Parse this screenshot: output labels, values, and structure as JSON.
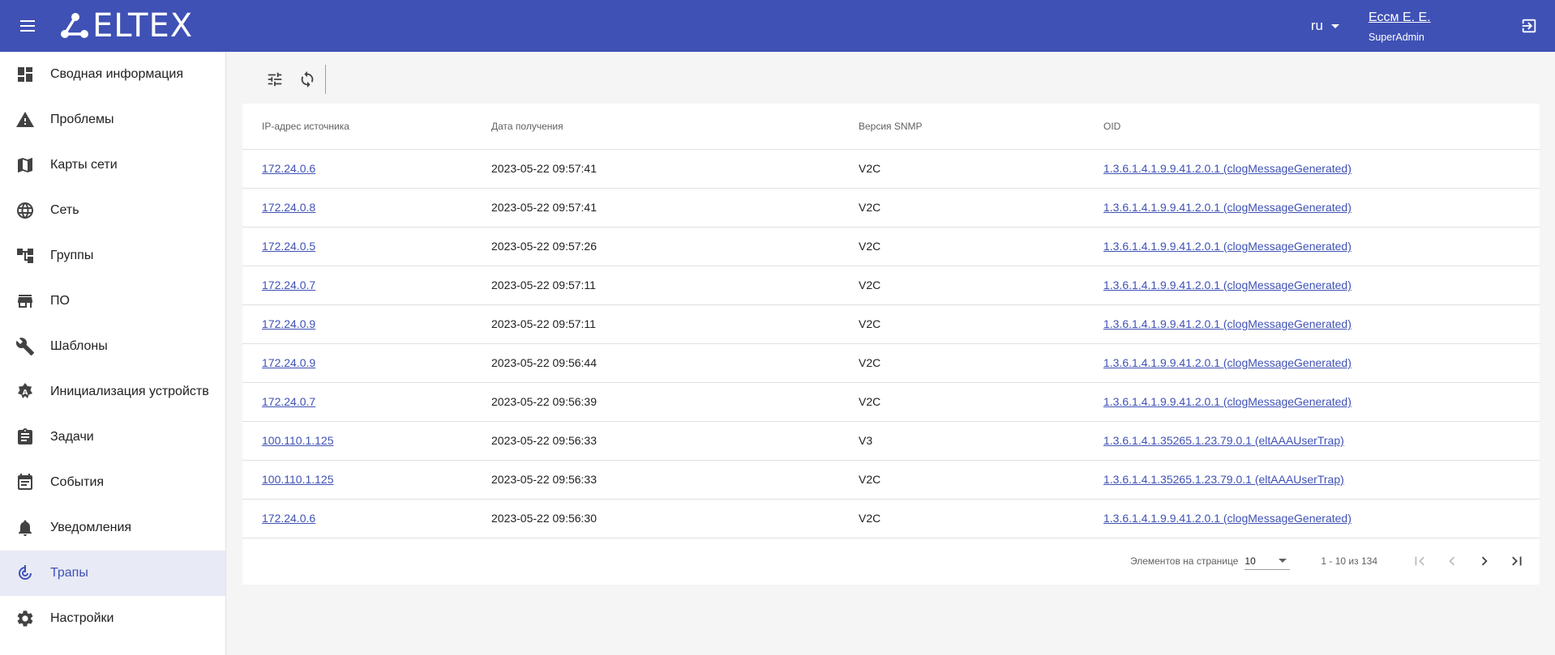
{
  "header": {
    "brand": "ELTEX",
    "language": "ru",
    "user_name": "Ессм Е. Е.",
    "user_role": "SuperAdmin"
  },
  "sidebar": {
    "items": [
      {
        "label": "Сводная информация",
        "icon": "dashboard-icon",
        "active": false
      },
      {
        "label": "Проблемы",
        "icon": "warning-icon",
        "active": false
      },
      {
        "label": "Карты сети",
        "icon": "map-icon",
        "active": false
      },
      {
        "label": "Сеть",
        "icon": "globe-icon",
        "active": false
      },
      {
        "label": "Группы",
        "icon": "tree-icon",
        "active": false
      },
      {
        "label": "ПО",
        "icon": "store-icon",
        "active": false
      },
      {
        "label": "Шаблоны",
        "icon": "wrench-icon",
        "active": false
      },
      {
        "label": "Инициализация устройств",
        "icon": "init-icon",
        "active": false
      },
      {
        "label": "Задачи",
        "icon": "clipboard-icon",
        "active": false
      },
      {
        "label": "События",
        "icon": "calendar-icon",
        "active": false
      },
      {
        "label": "Уведомления",
        "icon": "bell-icon",
        "active": false
      },
      {
        "label": "Трапы",
        "icon": "trap-icon",
        "active": true
      },
      {
        "label": "Настройки",
        "icon": "gear-icon",
        "active": false
      }
    ]
  },
  "table": {
    "columns": [
      "IP-адрес источника",
      "Дата получения",
      "Версия SNMP",
      "OID"
    ],
    "rows": [
      [
        "172.24.0.6",
        "2023-05-22 09:57:41",
        "V2C",
        "1.3.6.1.4.1.9.9.41.2.0.1 (clogMessageGenerated)"
      ],
      [
        "172.24.0.8",
        "2023-05-22 09:57:41",
        "V2C",
        "1.3.6.1.4.1.9.9.41.2.0.1 (clogMessageGenerated)"
      ],
      [
        "172.24.0.5",
        "2023-05-22 09:57:26",
        "V2C",
        "1.3.6.1.4.1.9.9.41.2.0.1 (clogMessageGenerated)"
      ],
      [
        "172.24.0.7",
        "2023-05-22 09:57:11",
        "V2C",
        "1.3.6.1.4.1.9.9.41.2.0.1 (clogMessageGenerated)"
      ],
      [
        "172.24.0.9",
        "2023-05-22 09:57:11",
        "V2C",
        "1.3.6.1.4.1.9.9.41.2.0.1 (clogMessageGenerated)"
      ],
      [
        "172.24.0.9",
        "2023-05-22 09:56:44",
        "V2C",
        "1.3.6.1.4.1.9.9.41.2.0.1 (clogMessageGenerated)"
      ],
      [
        "172.24.0.7",
        "2023-05-22 09:56:39",
        "V2C",
        "1.3.6.1.4.1.9.9.41.2.0.1 (clogMessageGenerated)"
      ],
      [
        "100.110.1.125",
        "2023-05-22 09:56:33",
        "V3",
        "1.3.6.1.4.1.35265.1.23.79.0.1 (eltAAAUserTrap)"
      ],
      [
        "100.110.1.125",
        "2023-05-22 09:56:33",
        "V2C",
        "1.3.6.1.4.1.35265.1.23.79.0.1 (eltAAAUserTrap)"
      ],
      [
        "172.24.0.6",
        "2023-05-22 09:56:30",
        "V2C",
        "1.3.6.1.4.1.9.9.41.2.0.1 (clogMessageGenerated)"
      ]
    ]
  },
  "paginator": {
    "items_per_page_label": "Элементов на странице",
    "page_size": "10",
    "range_label": "1 - 10 из 134"
  },
  "colors": {
    "primary": "#3f51b5",
    "active_bg": "#e8eaf6"
  }
}
